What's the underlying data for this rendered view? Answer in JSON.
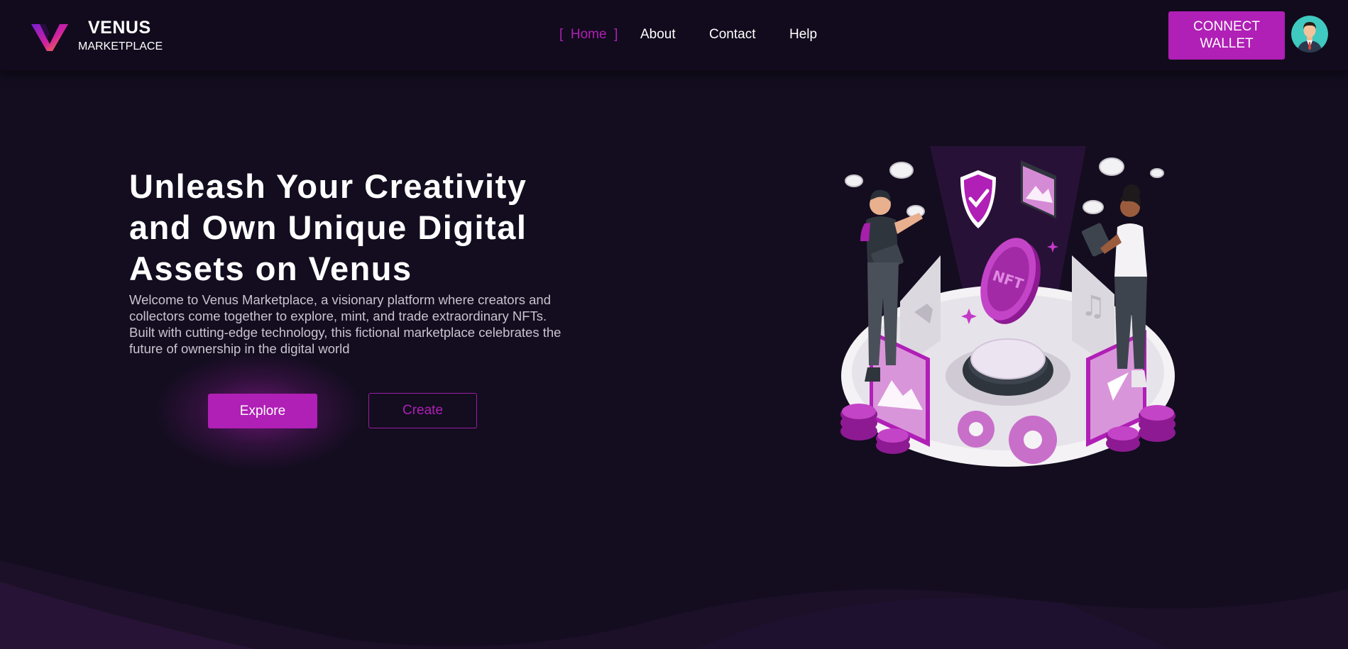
{
  "brand": {
    "name": "VENUS",
    "sub": "MARKETPLACE",
    "logo_icon": "venus-v-logo"
  },
  "nav": {
    "items": [
      {
        "label": "Home",
        "active": true
      },
      {
        "label": "About",
        "active": false
      },
      {
        "label": "Contact",
        "active": false
      },
      {
        "label": "Help",
        "active": false
      }
    ],
    "active_bracket_open": "[",
    "active_bracket_close": "]"
  },
  "header": {
    "connect_label_line1": "CONNECT",
    "connect_label_line2": "WALLET",
    "avatar_icon": "user-avatar-businessman"
  },
  "hero": {
    "title_line1": "Unleash Your Creativity",
    "title_line2": "and Own Unique Digital",
    "title_line3": "Assets on Venus",
    "description": "Welcome to Venus Marketplace, a visionary platform where creators and collectors come together to explore, mint, and trade extraordinary NFTs. Built with cutting-edge technology, this fictional marketplace celebrates the future of ownership in the digital world",
    "explore_label": "Explore",
    "create_label": "Create",
    "illustration_text": "NFT",
    "illustration_icon": "nft-marketplace-illustration"
  },
  "colors": {
    "background": "#130d1f",
    "header": "#120b1d",
    "accent": "#b01fb6",
    "text": "#ffffff",
    "muted_text": "#c9c4cf"
  }
}
